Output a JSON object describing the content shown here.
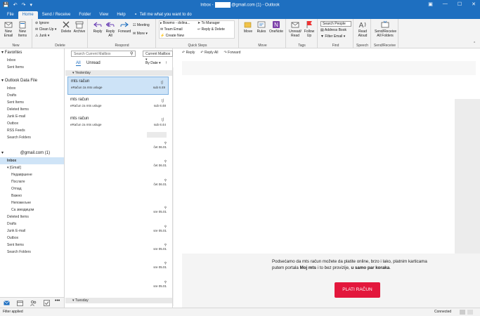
{
  "window": {
    "title_prefix": "Inbox - ",
    "title_suffix": "@gmail.com (1) - Outlook"
  },
  "tabs": [
    "File",
    "Home",
    "Send / Receive",
    "Folder",
    "View",
    "Help"
  ],
  "tell_me": "Tell me what you want to do",
  "ribbon": {
    "new_email": "New Email",
    "new_items": "New Items",
    "ignore": "Ignore",
    "clean_up": "Clean Up",
    "junk": "Junk",
    "delete": "Delete",
    "archive": "Archive",
    "reply": "Reply",
    "reply_all": "Reply All",
    "forward": "Forward",
    "meeting": "Meeting",
    "more": "More",
    "qs_1": "Bowmo - dolina...",
    "qs_2": "Team Email",
    "qs_3": "Create New",
    "qs_4": "To Manager",
    "qs_5": "Reply & Delete",
    "move": "Move",
    "rules": "Rules",
    "onenote": "OneNote",
    "unread_read": "Unread/ Read",
    "follow_up": "Follow Up",
    "search_people": "Search People",
    "address_book": "Address Book",
    "filter_email": "Filter Email",
    "read_aloud": "Read Aloud",
    "send_receive_all": "Send/Receive All Folders",
    "groups": [
      "New",
      "Delete",
      "Respond",
      "Quick Steps",
      "Move",
      "Tags",
      "Find",
      "Speech",
      "Send/Receive"
    ]
  },
  "nav": {
    "favorites_header": "Favorites",
    "favorites": [
      "Inbox",
      "Sent Items"
    ],
    "datafile_header": "Outlook Data File",
    "datafile_items": [
      "Inbox",
      "Drafts",
      "Sent Items",
      "Deleted Items",
      "Junk E-mail",
      "Outbox",
      "RSS Feeds",
      "Search Folders"
    ],
    "account_label": "@gmail.com",
    "account_count": "(1)",
    "account_items": [
      "Inbox",
      "[Gmail]",
      "Недавршене",
      "Послате",
      "Отпад",
      "Важно",
      "Непожељне",
      "Са звездицом",
      "Deleted Items",
      "Drafts",
      "Junk E-mail",
      "Outbox",
      "Sent Items",
      "Search Folders"
    ]
  },
  "list": {
    "search_placeholder": "Search Current Mailbox",
    "scope": "Current Mailbox",
    "filter_all": "All",
    "filter_unread": "Unread",
    "sort": "By Date",
    "group_yesterday": "Yesterday",
    "group_tuesday": "Tuesday",
    "emails": [
      {
        "sender": "mts račun",
        "subject": "eRačun za mts usluge",
        "time": "sub 6:49"
      },
      {
        "sender": "mts račun",
        "subject": "eRačun za mts usluge",
        "time": "sub 6:48"
      },
      {
        "sender": "mts račun",
        "subject": "eRačun za mts usluge",
        "time": "sub 6:44"
      }
    ],
    "stubs": [
      "čet 06.01",
      "čet 06.01",
      "čet 06.01",
      "sre 05.01",
      "sre 05.01",
      "sre 05.01",
      "sre 05.01",
      "sre 05.01"
    ]
  },
  "reading": {
    "reply": "Reply",
    "reply_all": "Reply All",
    "forward": "Forward",
    "body_1": "Podsećamo da mts račun možete da platite online, brzo i lako, platnim karticama putem portala ",
    "body_bold_1": "Moj mts",
    "body_2": " i to bez provizije, ",
    "body_bold_2": "u samo par koraka",
    "body_3": ".",
    "pay_button": "PLATI RAČUN"
  },
  "status": {
    "left": "Filter applied",
    "right": "Connected",
    "zoom": ""
  },
  "colors": {
    "accent": "#1e6fc0",
    "selection": "#cde3f7",
    "pay_button": "#e3173c"
  }
}
